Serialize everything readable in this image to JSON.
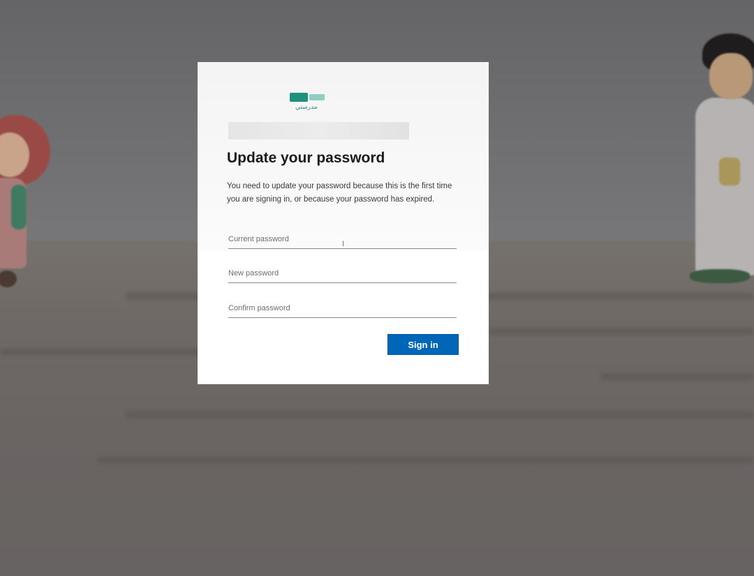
{
  "dialog": {
    "logo_text": "مدرستي",
    "title": "Update your password",
    "description": "You need to update your password because this is the first time you are signing in, or because your password has expired.",
    "fields": {
      "current_placeholder": "Current password",
      "new_placeholder": "New password",
      "confirm_placeholder": "Confirm password"
    },
    "sign_in_label": "Sign in"
  },
  "colors": {
    "button_blue": "#0067b8",
    "logo_teal": "#1f8f7e"
  }
}
